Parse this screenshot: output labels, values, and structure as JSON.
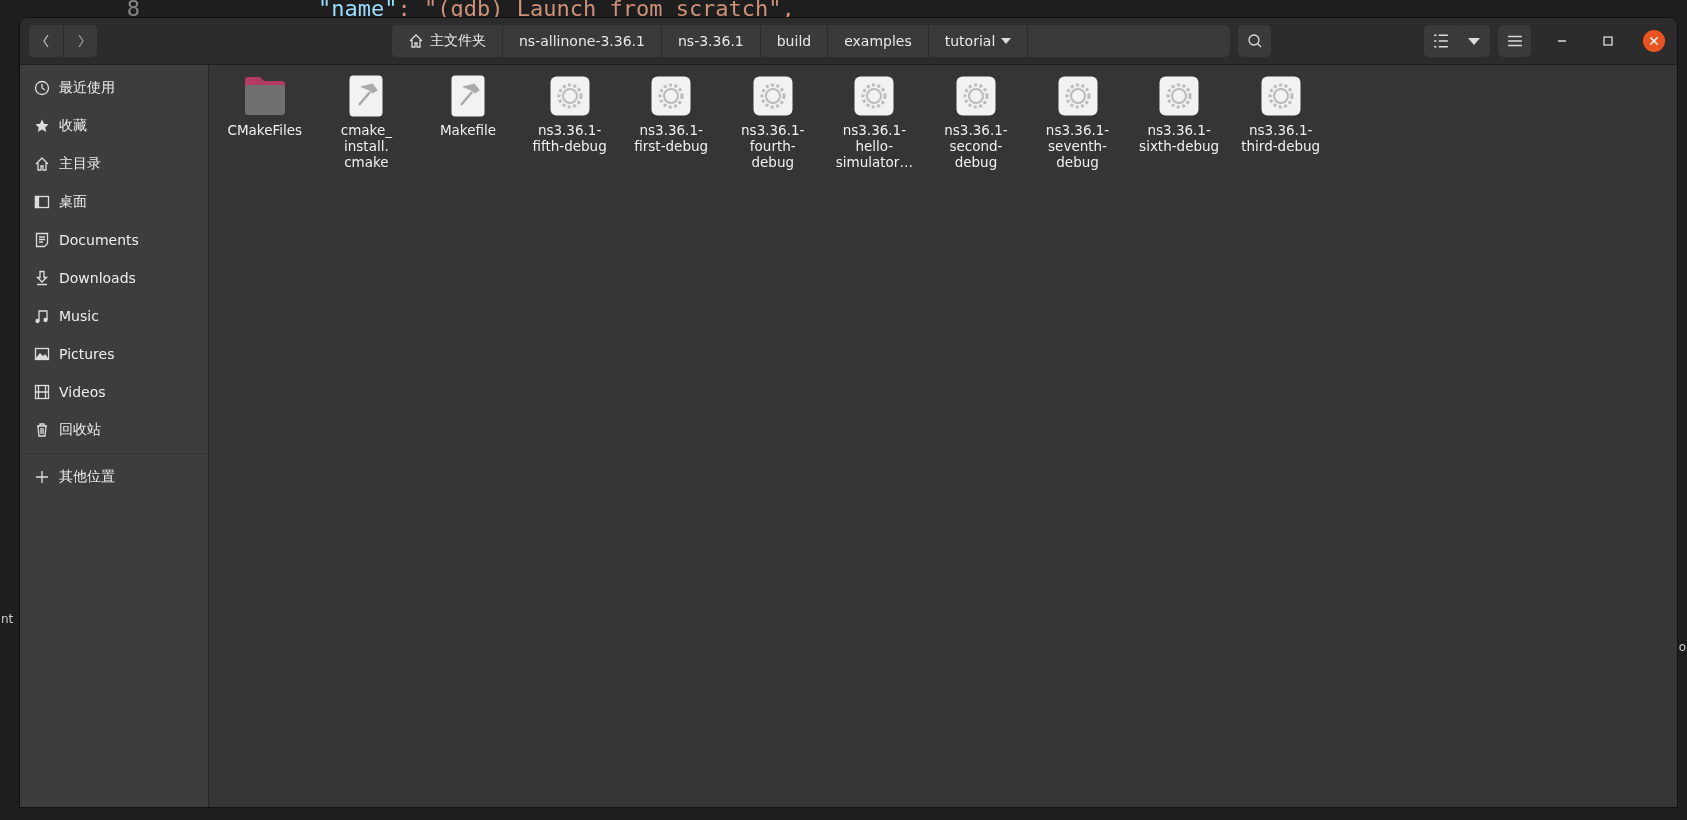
{
  "background_editor": {
    "line_number": "8",
    "code_key": "\"name\"",
    "code_rest": ": \"(gdb) Launch from scratch\",",
    "left_fragment": "nt",
    "right_fragment": "o"
  },
  "path_bar": {
    "home": "主文件夹",
    "segments": [
      "ns-allinone-3.36.1",
      "ns-3.36.1",
      "build",
      "examples",
      "tutorial"
    ]
  },
  "sidebar": {
    "items": [
      {
        "label": "最近使用",
        "kind": "recent"
      },
      {
        "label": "收藏",
        "kind": "starred"
      },
      {
        "label": "主目录",
        "kind": "home"
      },
      {
        "label": "桌面",
        "kind": "desktop"
      },
      {
        "label": "Documents",
        "kind": "documents"
      },
      {
        "label": "Downloads",
        "kind": "downloads"
      },
      {
        "label": "Music",
        "kind": "music"
      },
      {
        "label": "Pictures",
        "kind": "pictures"
      },
      {
        "label": "Videos",
        "kind": "videos"
      },
      {
        "label": "回收站",
        "kind": "trash"
      }
    ],
    "other": "其他位置"
  },
  "files": [
    {
      "name": "CMakeFiles",
      "kind": "folder"
    },
    {
      "name": "cmake_\ninstall.\ncmake",
      "kind": "script"
    },
    {
      "name": "Makefile",
      "kind": "script"
    },
    {
      "name": "ns3.36.1-\nfifth-debug",
      "kind": "executable"
    },
    {
      "name": "ns3.36.1-\nfirst-debug",
      "kind": "executable"
    },
    {
      "name": "ns3.36.1-\nfourth-\ndebug",
      "kind": "executable"
    },
    {
      "name": "ns3.36.1-\nhello-\nsimulator…",
      "kind": "executable"
    },
    {
      "name": "ns3.36.1-\nsecond-\ndebug",
      "kind": "executable"
    },
    {
      "name": "ns3.36.1-\nseventh-\ndebug",
      "kind": "executable"
    },
    {
      "name": "ns3.36.1-\nsixth-debug",
      "kind": "executable"
    },
    {
      "name": "ns3.36.1-\nthird-debug",
      "kind": "executable"
    }
  ]
}
